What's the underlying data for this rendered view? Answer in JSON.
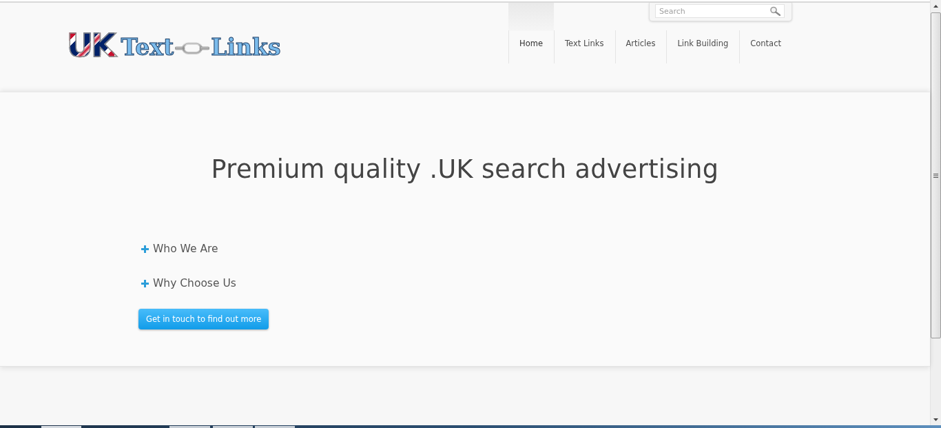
{
  "logo": {
    "mark": "UK",
    "words": [
      "Text",
      "Links"
    ]
  },
  "search": {
    "placeholder": "Search"
  },
  "nav": [
    {
      "label": "Home",
      "selected": true
    },
    {
      "label": "Text Links",
      "selected": false
    },
    {
      "label": "Articles",
      "selected": false
    },
    {
      "label": "Link Building",
      "selected": false
    },
    {
      "label": "Contact",
      "selected": false
    }
  ],
  "hero": {
    "headline": "Premium quality .UK search advertising"
  },
  "sections": [
    {
      "label": "Who We Are",
      "expanded": false
    },
    {
      "label": "Why Choose Us",
      "expanded": false
    }
  ],
  "cta": {
    "label": "Get in touch to find out more"
  }
}
